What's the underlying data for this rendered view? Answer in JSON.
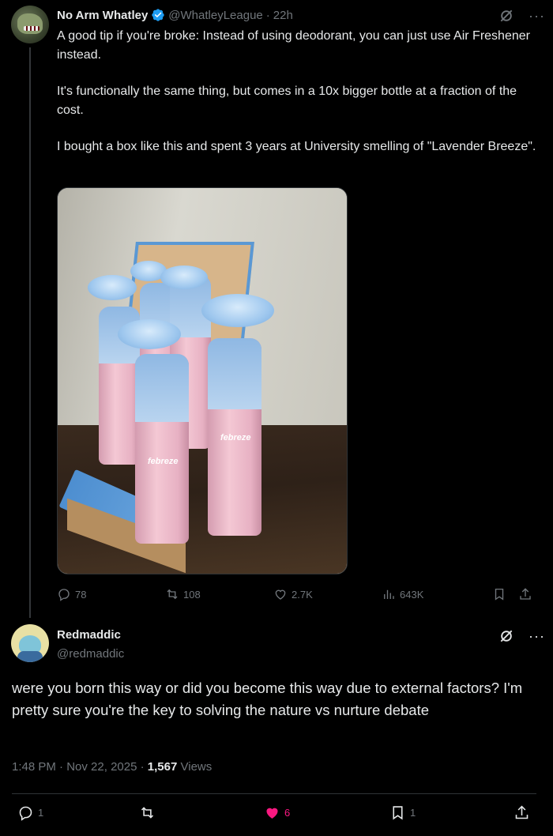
{
  "tweet": {
    "author_name": "No Arm Whatley",
    "handle": "@WhatleyLeague",
    "separator": "·",
    "time": "22h",
    "paragraphs": [
      "A good tip if you're broke: Instead of using deodorant, you can just use Air Freshener instead.",
      "It's functionally the same thing, but comes in a 10x bigger bottle at a fraction of the cost.",
      "I bought a box like this and spent 3 years at University smelling of \"Lavender Breeze\"."
    ],
    "image_brand_text": "febreze",
    "stats": {
      "replies": "78",
      "reposts": "108",
      "likes": "2.7K",
      "views": "643K"
    }
  },
  "reply": {
    "author_name": "Redmaddic",
    "handle": "@redmaddic",
    "text": "were you born this way or did you become this way due to external factors? I'm pretty sure you're the key to solving the nature vs nurture debate",
    "time": "1:48 PM",
    "date": "Nov 22, 2025",
    "separator": "·",
    "views_count": "1,567",
    "views_label": "Views",
    "stats": {
      "replies": "1",
      "likes": "6",
      "bookmarks": "1"
    }
  },
  "icons": {
    "verified": "verified-badge-icon",
    "grok": "grok-icon",
    "more": "more-icon",
    "reply": "reply-icon",
    "repost": "repost-icon",
    "like": "heart-icon",
    "views": "views-icon",
    "bookmark": "bookmark-icon",
    "share": "share-icon"
  },
  "colors": {
    "background": "#000000",
    "text": "#e7e9ea",
    "muted": "#71767b",
    "verified": "#1d9bf0",
    "like_active": "#f91880"
  }
}
